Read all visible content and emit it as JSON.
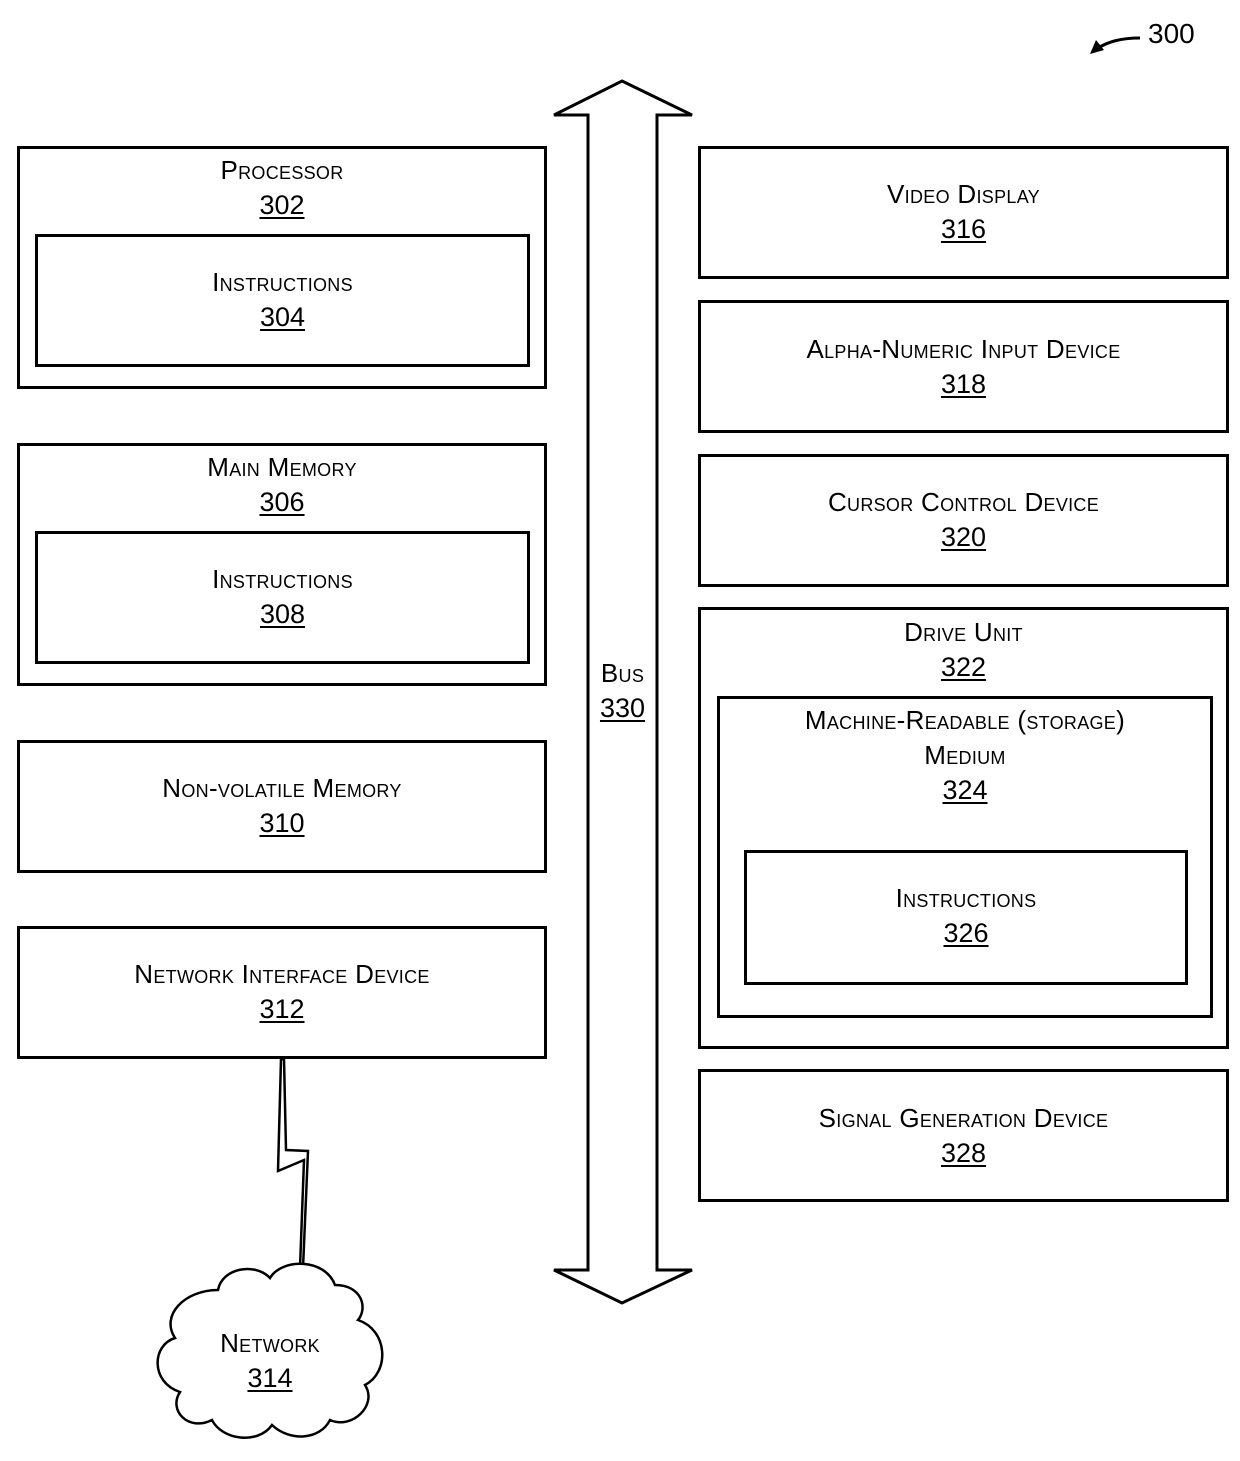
{
  "figure": {
    "ref": "300"
  },
  "bus": {
    "label": "Bus",
    "ref": "330"
  },
  "left": {
    "processor": {
      "label": "Processor",
      "ref": "302",
      "instructions": {
        "label": "Instructions",
        "ref": "304"
      }
    },
    "main_memory": {
      "label": "Main Memory",
      "ref": "306",
      "instructions": {
        "label": "Instructions",
        "ref": "308"
      }
    },
    "non_volatile_memory": {
      "label": "Non-volatile Memory",
      "ref": "310"
    },
    "network_interface": {
      "label": "Network Interface Device",
      "ref": "312"
    },
    "network": {
      "label": "Network",
      "ref": "314"
    }
  },
  "right": {
    "video_display": {
      "label": "Video Display",
      "ref": "316"
    },
    "alpha_numeric": {
      "label": "Alpha-Numeric Input Device",
      "ref": "318"
    },
    "cursor_control": {
      "label": "Cursor Control Device",
      "ref": "320"
    },
    "drive_unit": {
      "label": "Drive Unit",
      "ref": "322",
      "medium": {
        "label_line1": "Machine-Readable (storage)",
        "label_line2": "Medium",
        "ref": "324",
        "instructions": {
          "label": "Instructions",
          "ref": "326"
        }
      }
    },
    "signal_generation": {
      "label": "Signal Generation Device",
      "ref": "328"
    }
  }
}
